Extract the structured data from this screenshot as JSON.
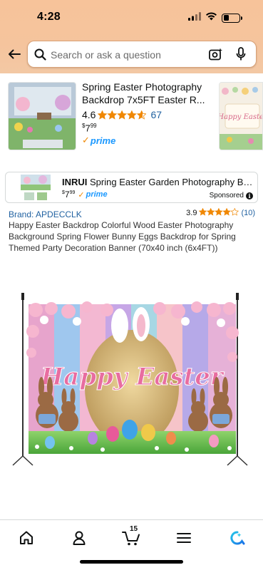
{
  "status_bar": {
    "time": "4:28"
  },
  "search": {
    "placeholder": "Search or ask a question"
  },
  "carousel": {
    "title": "Spring Easter Photography Backdrop 7x5FT Easter R...",
    "rating": "4.6",
    "rating_count": "67",
    "price_symbol": "$",
    "price_whole": "7",
    "price_fraction": "99",
    "prime": "prime",
    "next_thumb_text": "Happy Easter"
  },
  "sponsored_banner": {
    "brand": "INRUI",
    "title": "Spring Easter Garden Photography Back...",
    "price_symbol": "$",
    "price_whole": "7",
    "price_fraction": "99",
    "prime": "prime",
    "sponsored_label": "Sponsored",
    "info": "i"
  },
  "item": {
    "brand": "Brand: APDECCLK",
    "rating": "3.9",
    "rating_count": "(10)",
    "title": "Happy Easter Backdrop Colorful Wood Easter Photography Background Spring Flower Bunny Eggs Backdrop for Spring Themed Party Decoration Banner (70x40 inch (6x4FT))",
    "image_text": "Happy Easter"
  },
  "bottom_nav": {
    "cart_count": "15",
    "items": [
      "home-icon",
      "account-icon",
      "cart-icon",
      "menu-icon",
      "rufus-icon"
    ]
  },
  "colors": {
    "accent_orange": "#f08804",
    "link_blue": "#2162a1",
    "prime_blue": "#1a98ff",
    "star": "#f08804",
    "header_bg": "#f7c39a"
  }
}
